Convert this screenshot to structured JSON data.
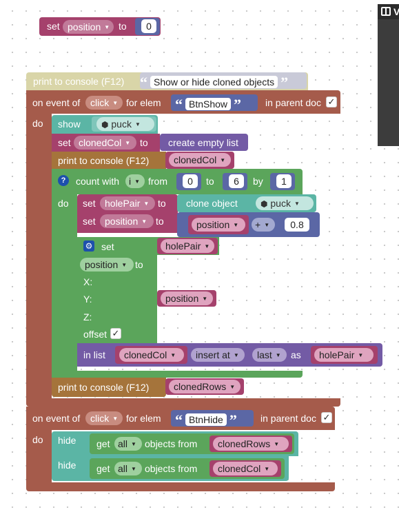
{
  "colors": {
    "variables": "#a5416c",
    "text": "#5b67a5",
    "lists": "#735ba5",
    "loops": "#5ba55b",
    "events": "#a55b4b",
    "console": "#a5743b",
    "objects": "#5bb5a5"
  },
  "top_set": {
    "set": "set",
    "var": "position",
    "to": "to",
    "value": "0"
  },
  "print1": {
    "label": "print to console (F12)",
    "message": "Show or hide cloned objects"
  },
  "event_show": {
    "on_event": "on event of",
    "event": "click",
    "for_elem": "for elem",
    "elem": "BtnShow",
    "in_parent": "in parent doc",
    "do": "do",
    "show": "show",
    "puck1": "puck",
    "set1": "set",
    "cloned_col_var": "clonedCol",
    "to1": "to",
    "create_list": "create empty list",
    "print2": "print to console (F12)",
    "print2_var": "clonedCol",
    "count_with": "count with",
    "count_var": "i",
    "from": "from",
    "from_val": "0",
    "to_word": "to",
    "to_val": "6",
    "by": "by",
    "by_val": "1",
    "loop_do": "do",
    "set2": "set",
    "hole_pair_var": "holePair",
    "to2": "to",
    "clone_object": "clone object",
    "puck2": "puck",
    "set3": "set",
    "position_var": "position",
    "to3": "to",
    "math_var": "position",
    "math_op": "+",
    "math_val": "0.8",
    "setprop_set": "set",
    "setprop_obj": "holePair",
    "setprop_prop": "position",
    "setprop_to": "to",
    "x_label": "X:",
    "y_label": "Y:",
    "y_var": "position",
    "z_label": "Z:",
    "offset_label": "offset",
    "in_list": "in list",
    "in_list_var": "clonedCol",
    "insert_at": "insert at",
    "last": "last",
    "as_word": "as",
    "as_var": "holePair",
    "print3": "print to console (F12)",
    "print3_var": "clonedRows",
    "checkmark": "✓"
  },
  "event_hide": {
    "on_event": "on event of",
    "event": "click",
    "for_elem": "for elem",
    "elem": "BtnHide",
    "in_parent": "in parent doc",
    "do": "do",
    "hide1": "hide",
    "get1": "get",
    "all1": "all",
    "objects_from1": "objects from",
    "src1": "clonedRows",
    "hide2": "hide",
    "get2": "get",
    "all2": "all",
    "objects_from2": "objects from",
    "src2": "clonedCol",
    "checkmark": "✓"
  },
  "panel": {
    "label": "V"
  }
}
